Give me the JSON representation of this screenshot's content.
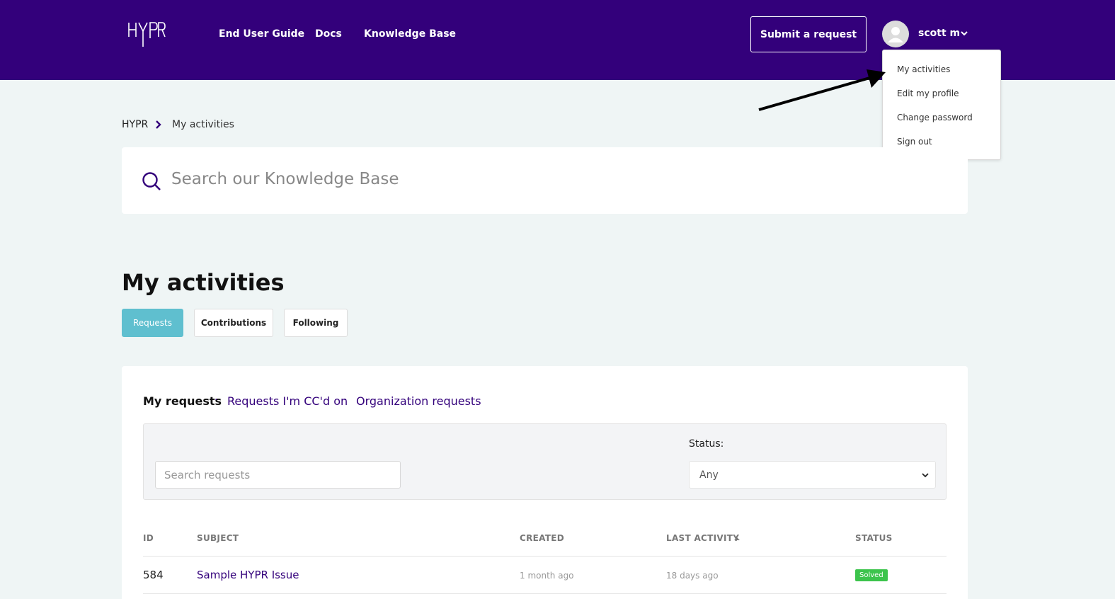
{
  "header": {
    "brand": "HYPR",
    "nav": [
      {
        "label": "End User Guide"
      },
      {
        "label": "Docs"
      },
      {
        "label": "Knowledge Base"
      }
    ],
    "submit_label": "Submit a request",
    "user_name": "scott m"
  },
  "user_menu": {
    "items": [
      {
        "label": "My activities"
      },
      {
        "label": "Edit my profile"
      },
      {
        "label": "Change password"
      },
      {
        "label": "Sign out"
      }
    ]
  },
  "breadcrumb": {
    "home": "HYPR",
    "current": "My activities"
  },
  "search": {
    "placeholder": "Search our Knowledge Base"
  },
  "page": {
    "title": "My activities",
    "tabs": [
      {
        "label": "Requests",
        "active": true
      },
      {
        "label": "Contributions",
        "active": false
      },
      {
        "label": "Following",
        "active": false
      }
    ]
  },
  "requests": {
    "subnav": [
      {
        "label": "My requests",
        "current": true
      },
      {
        "label": "Requests I'm CC'd on",
        "current": false
      },
      {
        "label": "Organization requests",
        "current": false
      }
    ],
    "separator": "·",
    "search_placeholder": "Search requests",
    "status_label": "Status:",
    "status_value": "Any",
    "columns": [
      "ID",
      "SUBJECT",
      "CREATED",
      "LAST ACTIVITY",
      "STATUS"
    ],
    "rows": [
      {
        "id": "584",
        "subject": "Sample HYPR Issue",
        "created": "1 month ago",
        "last_activity": "18 days ago",
        "status": "Solved"
      }
    ]
  },
  "colors": {
    "brand_purple": "#33007b",
    "active_tab": "#5fbfcf",
    "solved_badge": "#3cc44c"
  }
}
